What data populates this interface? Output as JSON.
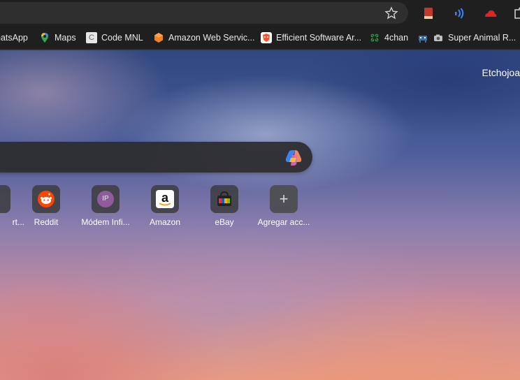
{
  "bookmarks": [
    {
      "label": "hatsApp",
      "icon": "whatsapp-icon"
    },
    {
      "label": "Maps",
      "icon": "maps-pin-icon"
    },
    {
      "label": "Code MNL",
      "icon": "code-mnl-icon"
    },
    {
      "label": "Amazon Web Servic...",
      "icon": "aws-hexagon-icon"
    },
    {
      "label": "Efficient Software Ar...",
      "icon": "brave-lion-icon"
    },
    {
      "label": "4chan",
      "icon": "clover-icon"
    },
    {
      "label": "Super Animal R...",
      "icon": "pixel-animal-icon"
    }
  ],
  "user_name": "Etchojoa",
  "shortcuts": [
    {
      "label": "rt...",
      "icon": "partial-icon"
    },
    {
      "label": "Reddit",
      "icon": "reddit-icon"
    },
    {
      "label": "Módem Infi...",
      "icon": "ip-icon",
      "badge": "IP"
    },
    {
      "label": "Amazon",
      "icon": "amazon-icon",
      "badge": "a"
    },
    {
      "label": "eBay",
      "icon": "ebay-bag-icon"
    },
    {
      "label": "Agregar acc...",
      "icon": "plus-icon",
      "badge": "+"
    }
  ],
  "colors": {
    "toolbar": "#1f1f1f",
    "address_bar": "#2f2f2f",
    "reddit": "#ff4500",
    "ip_badge": "#8e5b9b"
  }
}
